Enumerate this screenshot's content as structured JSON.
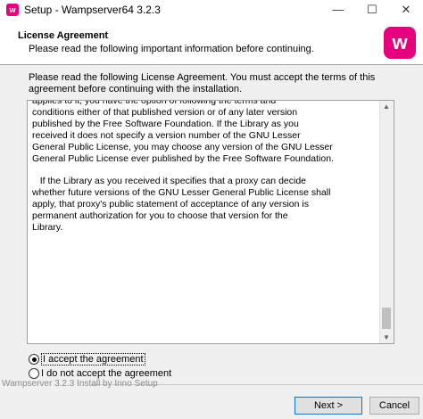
{
  "window": {
    "app_icon": "w",
    "title": "Setup - Wampserver64 3.2.3"
  },
  "header": {
    "title": "License Agreement",
    "subtitle": "Please read the following important information before continuing.",
    "logo_letter": "w"
  },
  "intro": "Please read the following License Agreement. You must accept the terms of this agreement before continuing with the installation.",
  "license_text": "applies to it, you have the option of following the terms and\nconditions either of that published version or of any later version\npublished by the Free Software Foundation. If the Library as you\nreceived it does not specify a version number of the GNU Lesser\nGeneral Public License, you may choose any version of the GNU Lesser\nGeneral Public License ever published by the Free Software Foundation.\n\n   If the Library as you received it specifies that a proxy can decide\nwhether future versions of the GNU Lesser General Public License shall\napply, that proxy's public statement of acceptance of any version is\npermanent authorization for you to choose that version for the\nLibrary.",
  "options": {
    "accept": "I accept the agreement",
    "decline": "I do not accept the agreement",
    "selected": "accept"
  },
  "footer": {
    "brand": "Wampserver 3.2.3 Install by Inno Setup"
  },
  "buttons": {
    "next": "Next >",
    "cancel": "Cancel"
  }
}
